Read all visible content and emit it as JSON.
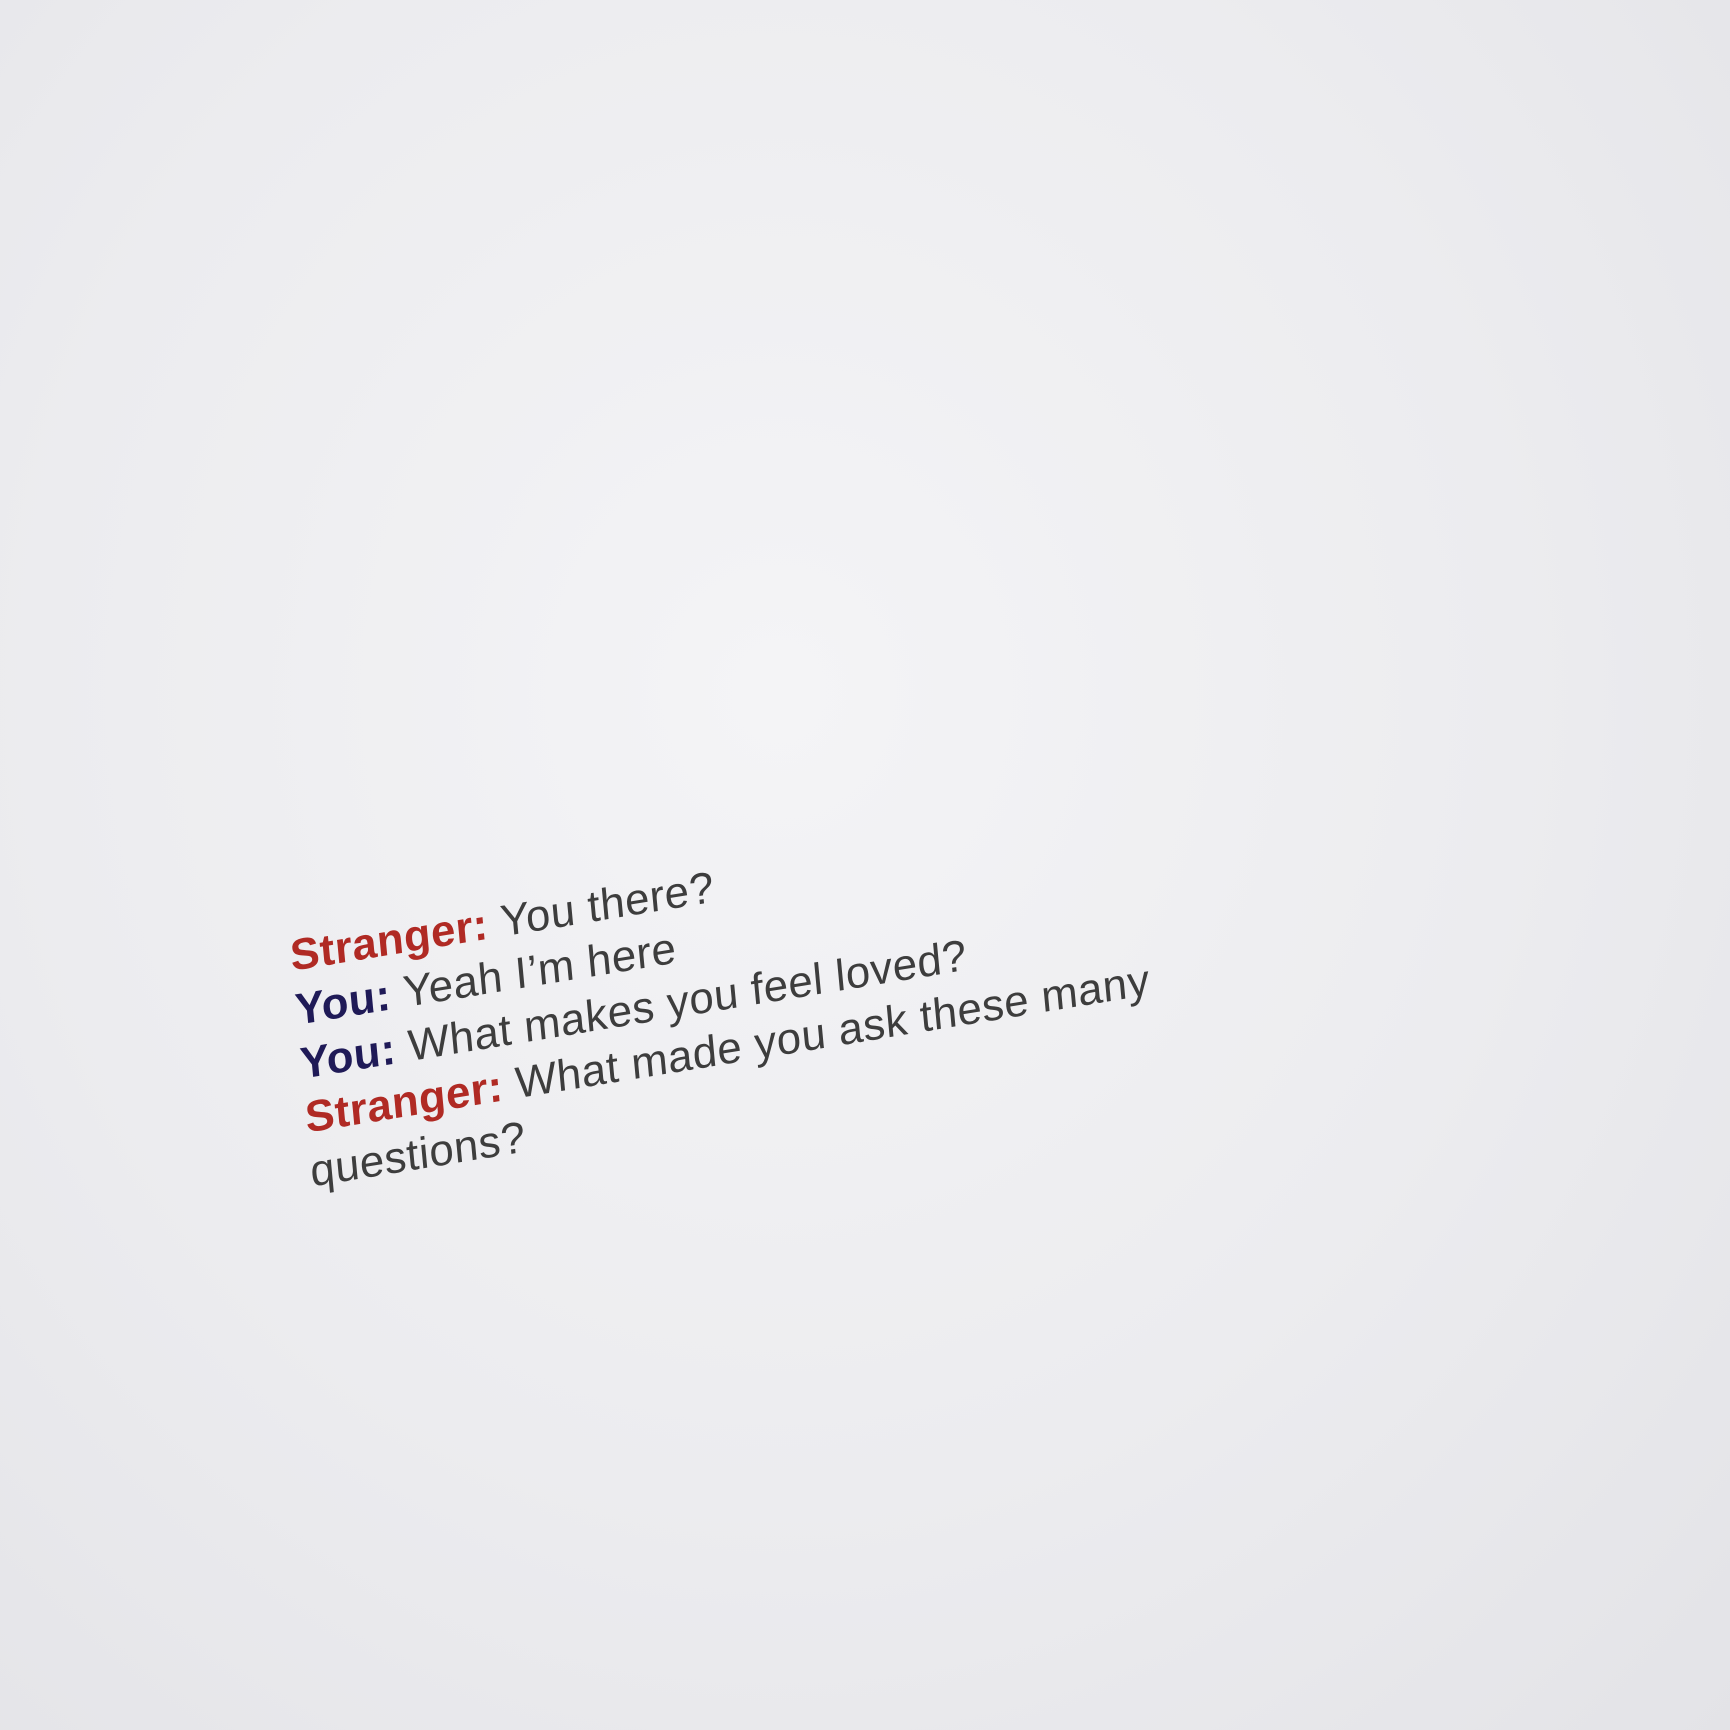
{
  "colors": {
    "stranger": "#b02a24",
    "you": "#1f1a57",
    "message": "#3d3d3d",
    "paper": "#ececef"
  },
  "chat": {
    "lines": [
      {
        "speaker": "Stranger:",
        "role": "stranger",
        "text": "You there?"
      },
      {
        "speaker": "You:",
        "role": "you",
        "text": "Yeah I’m here"
      },
      {
        "speaker": "You:",
        "role": "you",
        "text": "What makes you feel loved?"
      },
      {
        "speaker": "Stranger:",
        "role": "stranger",
        "text": "What made you ask these many questions?"
      }
    ]
  }
}
